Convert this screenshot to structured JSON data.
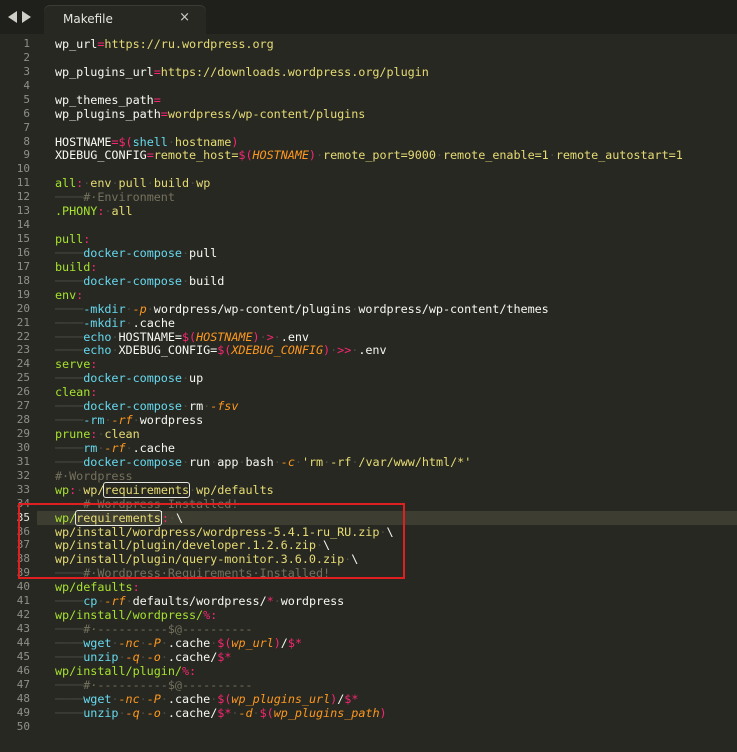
{
  "window": {
    "nav_back_icon": "triangle-left-icon",
    "nav_forward_icon": "triangle-right-icon",
    "tab": {
      "title": "Makefile",
      "close_glyph": "×"
    }
  },
  "editor": {
    "current_line": 35,
    "colors": {
      "background": "#272822",
      "keyword": "#f92672",
      "target": "#a6e22e",
      "builtin": "#66d9ef",
      "variable": "#fd971f",
      "string": "#e6db74",
      "comment": "#75715e",
      "annotation_box": "#e02020"
    },
    "lines": [
      [
        [
          "default",
          "wp_url"
        ],
        [
          "keyword",
          "="
        ],
        [
          "string",
          "https://ru.wordpress.org"
        ]
      ],
      [],
      [
        [
          "default",
          "wp_plugins_url"
        ],
        [
          "keyword",
          "="
        ],
        [
          "string",
          "https://downloads.wordpress.org/plugin"
        ]
      ],
      [],
      [
        [
          "default",
          "wp_themes_path"
        ],
        [
          "keyword",
          "="
        ]
      ],
      [
        [
          "default",
          "wp_plugins_path"
        ],
        [
          "keyword",
          "="
        ],
        [
          "string",
          "wordpress/wp-content/plugins"
        ]
      ],
      [],
      [
        [
          "default",
          "HOSTNAME"
        ],
        [
          "keyword",
          "=$("
        ],
        [
          "builtin",
          "shell"
        ],
        [
          "ws",
          "·"
        ],
        [
          "string",
          "hostname"
        ],
        [
          "keyword",
          ")"
        ]
      ],
      [
        [
          "default",
          "XDEBUG_CONFIG"
        ],
        [
          "keyword",
          "="
        ],
        [
          "string",
          "remote_host="
        ],
        [
          "keyword",
          "$("
        ],
        [
          "var",
          "HOSTNAME"
        ],
        [
          "keyword",
          ")"
        ],
        [
          "ws",
          "·"
        ],
        [
          "string",
          "remote_port=9000"
        ],
        [
          "ws",
          "·"
        ],
        [
          "string",
          "remote_enable=1"
        ],
        [
          "ws",
          "·"
        ],
        [
          "string",
          "remote_autostart=1"
        ]
      ],
      [],
      [
        [
          "target",
          "all"
        ],
        [
          "keyword",
          ":"
        ],
        [
          "ws",
          "·"
        ],
        [
          "string",
          "env"
        ],
        [
          "ws",
          "·"
        ],
        [
          "string",
          "pull"
        ],
        [
          "ws",
          "·"
        ],
        [
          "string",
          "build"
        ],
        [
          "ws",
          "·"
        ],
        [
          "string",
          "wp"
        ]
      ],
      [
        [
          "ws",
          "────"
        ],
        [
          "comment",
          "#·Environment"
        ]
      ],
      [
        [
          "target",
          ".PHONY"
        ],
        [
          "keyword",
          ":"
        ],
        [
          "ws",
          "·"
        ],
        [
          "string",
          "all"
        ]
      ],
      [],
      [
        [
          "target",
          "pull"
        ],
        [
          "keyword",
          ":"
        ]
      ],
      [
        [
          "ws",
          "────"
        ],
        [
          "builtin",
          "docker-compose"
        ],
        [
          "ws",
          "·"
        ],
        [
          "default",
          "pull"
        ]
      ],
      [
        [
          "target",
          "build"
        ],
        [
          "keyword",
          ":"
        ]
      ],
      [
        [
          "ws",
          "────"
        ],
        [
          "builtin",
          "docker-compose"
        ],
        [
          "ws",
          "·"
        ],
        [
          "default",
          "build"
        ]
      ],
      [
        [
          "target",
          "env"
        ],
        [
          "keyword",
          ":"
        ]
      ],
      [
        [
          "ws",
          "────"
        ],
        [
          "builtin",
          "-mkdir"
        ],
        [
          "ws",
          "·"
        ],
        [
          "var",
          "-p"
        ],
        [
          "ws",
          "·"
        ],
        [
          "default",
          "wordpress/wp-content/plugins"
        ],
        [
          "ws",
          "·"
        ],
        [
          "default",
          "wordpress/wp-content/themes"
        ]
      ],
      [
        [
          "ws",
          "────"
        ],
        [
          "builtin",
          "-mkdir"
        ],
        [
          "ws",
          "·"
        ],
        [
          "default",
          ".cache"
        ]
      ],
      [
        [
          "ws",
          "────"
        ],
        [
          "builtin",
          "echo"
        ],
        [
          "ws",
          "·"
        ],
        [
          "default",
          "HOSTNAME="
        ],
        [
          "keyword",
          "$("
        ],
        [
          "var",
          "HOSTNAME"
        ],
        [
          "keyword",
          ")"
        ],
        [
          "ws",
          "·"
        ],
        [
          "keyword",
          ">"
        ],
        [
          "ws",
          "·"
        ],
        [
          "default",
          ".env"
        ]
      ],
      [
        [
          "ws",
          "────"
        ],
        [
          "builtin",
          "echo"
        ],
        [
          "ws",
          "·"
        ],
        [
          "default",
          "XDEBUG_CONFIG="
        ],
        [
          "keyword",
          "$("
        ],
        [
          "var",
          "XDEBUG_CONFIG"
        ],
        [
          "keyword",
          ")"
        ],
        [
          "ws",
          "·"
        ],
        [
          "keyword",
          ">>"
        ],
        [
          "ws",
          "·"
        ],
        [
          "default",
          ".env"
        ]
      ],
      [
        [
          "target",
          "serve"
        ],
        [
          "keyword",
          ":"
        ]
      ],
      [
        [
          "ws",
          "────"
        ],
        [
          "builtin",
          "docker-compose"
        ],
        [
          "ws",
          "·"
        ],
        [
          "default",
          "up"
        ]
      ],
      [
        [
          "target",
          "clean"
        ],
        [
          "keyword",
          ":"
        ]
      ],
      [
        [
          "ws",
          "────"
        ],
        [
          "builtin",
          "docker-compose"
        ],
        [
          "ws",
          "·"
        ],
        [
          "default",
          "rm"
        ],
        [
          "ws",
          "·"
        ],
        [
          "var",
          "-fsv"
        ]
      ],
      [
        [
          "ws",
          "────"
        ],
        [
          "builtin",
          "-rm"
        ],
        [
          "ws",
          "·"
        ],
        [
          "var",
          "-rf"
        ],
        [
          "ws",
          "·"
        ],
        [
          "default",
          "wordpress"
        ]
      ],
      [
        [
          "target",
          "prune"
        ],
        [
          "keyword",
          ":"
        ],
        [
          "ws",
          "·"
        ],
        [
          "string",
          "clean"
        ]
      ],
      [
        [
          "ws",
          "────"
        ],
        [
          "builtin",
          "rm"
        ],
        [
          "ws",
          "·"
        ],
        [
          "var",
          "-rf"
        ],
        [
          "ws",
          "·"
        ],
        [
          "default",
          ".cache"
        ]
      ],
      [
        [
          "ws",
          "────"
        ],
        [
          "builtin",
          "docker-compose"
        ],
        [
          "ws",
          "·"
        ],
        [
          "default",
          "run"
        ],
        [
          "ws",
          "·"
        ],
        [
          "default",
          "app"
        ],
        [
          "ws",
          "·"
        ],
        [
          "default",
          "bash"
        ],
        [
          "ws",
          "·"
        ],
        [
          "var",
          "-c"
        ],
        [
          "ws",
          "·"
        ],
        [
          "string",
          "'rm"
        ],
        [
          "ws",
          "·"
        ],
        [
          "string",
          "-rf"
        ],
        [
          "ws",
          "·"
        ],
        [
          "string",
          "/var/www/html/*'"
        ]
      ],
      [
        [
          "comment",
          "#·Wordpress"
        ]
      ],
      [
        [
          "target",
          "wp"
        ],
        [
          "keyword",
          ":"
        ],
        [
          "ws",
          "·"
        ],
        [
          "string",
          "wp/"
        ],
        [
          "match",
          "requirements"
        ],
        [
          "ws",
          "·"
        ],
        [
          "string",
          "wp/defaults"
        ]
      ],
      [
        [
          "ws",
          "────"
        ],
        [
          "comment",
          "#·Wordpress·Installed!"
        ]
      ],
      [
        [
          "target",
          "wp/"
        ],
        [
          "match",
          "requirements"
        ],
        [
          "caret",
          ""
        ],
        [
          "keyword",
          ":"
        ],
        [
          "ws",
          "·"
        ],
        [
          "default",
          "\\"
        ]
      ],
      [
        [
          "string",
          "wp/install/wordpress/wordpress-5.4.1-ru_RU.zip"
        ],
        [
          "ws",
          "·"
        ],
        [
          "default",
          "\\"
        ]
      ],
      [
        [
          "string",
          "wp/install/plugin/developer.1.2.6.zip"
        ],
        [
          "ws",
          "·"
        ],
        [
          "default",
          "\\"
        ]
      ],
      [
        [
          "string",
          "wp/install/plugin/query-monitor.3.6.0.zip"
        ],
        [
          "ws",
          "·"
        ],
        [
          "default",
          "\\"
        ]
      ],
      [
        [
          "ws",
          "────"
        ],
        [
          "comment",
          "#·Wordpress·Requirements·Installed!"
        ]
      ],
      [
        [
          "target",
          "wp/defaults"
        ],
        [
          "keyword",
          ":"
        ]
      ],
      [
        [
          "ws",
          "────"
        ],
        [
          "builtin",
          "cp"
        ],
        [
          "ws",
          "·"
        ],
        [
          "var",
          "-rf"
        ],
        [
          "ws",
          "·"
        ],
        [
          "default",
          "defaults/wordpress/"
        ],
        [
          "keyword",
          "*"
        ],
        [
          "ws",
          "·"
        ],
        [
          "default",
          "wordpress"
        ]
      ],
      [
        [
          "target",
          "wp/install/wordpress/"
        ],
        [
          "keyword",
          "%:"
        ]
      ],
      [
        [
          "ws",
          "────"
        ],
        [
          "comment",
          "#·----------$@----------"
        ]
      ],
      [
        [
          "ws",
          "────"
        ],
        [
          "builtin",
          "wget"
        ],
        [
          "ws",
          "·"
        ],
        [
          "var",
          "-nc"
        ],
        [
          "ws",
          "·"
        ],
        [
          "var",
          "-P"
        ],
        [
          "ws",
          "·"
        ],
        [
          "default",
          ".cache"
        ],
        [
          "ws",
          "·"
        ],
        [
          "keyword",
          "$("
        ],
        [
          "var",
          "wp_url"
        ],
        [
          "keyword",
          ")"
        ],
        [
          "default",
          "/"
        ],
        [
          "keyword",
          "$*"
        ]
      ],
      [
        [
          "ws",
          "────"
        ],
        [
          "builtin",
          "unzip"
        ],
        [
          "ws",
          "·"
        ],
        [
          "var",
          "-q"
        ],
        [
          "ws",
          "·"
        ],
        [
          "var",
          "-o"
        ],
        [
          "ws",
          "·"
        ],
        [
          "default",
          ".cache/"
        ],
        [
          "keyword",
          "$*"
        ]
      ],
      [
        [
          "target",
          "wp/install/plugin/"
        ],
        [
          "keyword",
          "%:"
        ]
      ],
      [
        [
          "ws",
          "────"
        ],
        [
          "comment",
          "#·----------$@----------"
        ]
      ],
      [
        [
          "ws",
          "────"
        ],
        [
          "builtin",
          "wget"
        ],
        [
          "ws",
          "·"
        ],
        [
          "var",
          "-nc"
        ],
        [
          "ws",
          "·"
        ],
        [
          "var",
          "-P"
        ],
        [
          "ws",
          "·"
        ],
        [
          "default",
          ".cache"
        ],
        [
          "ws",
          "·"
        ],
        [
          "keyword",
          "$("
        ],
        [
          "var",
          "wp_plugins_url"
        ],
        [
          "keyword",
          ")"
        ],
        [
          "default",
          "/"
        ],
        [
          "keyword",
          "$*"
        ]
      ],
      [
        [
          "ws",
          "────"
        ],
        [
          "builtin",
          "unzip"
        ],
        [
          "ws",
          "·"
        ],
        [
          "var",
          "-q"
        ],
        [
          "ws",
          "·"
        ],
        [
          "var",
          "-o"
        ],
        [
          "ws",
          "·"
        ],
        [
          "default",
          ".cache/"
        ],
        [
          "keyword",
          "$*"
        ],
        [
          "ws",
          "·"
        ],
        [
          "var",
          "-d"
        ],
        [
          "ws",
          "·"
        ],
        [
          "keyword",
          "$("
        ],
        [
          "var",
          "wp_plugins_path"
        ],
        [
          "keyword",
          ")"
        ]
      ],
      []
    ]
  }
}
